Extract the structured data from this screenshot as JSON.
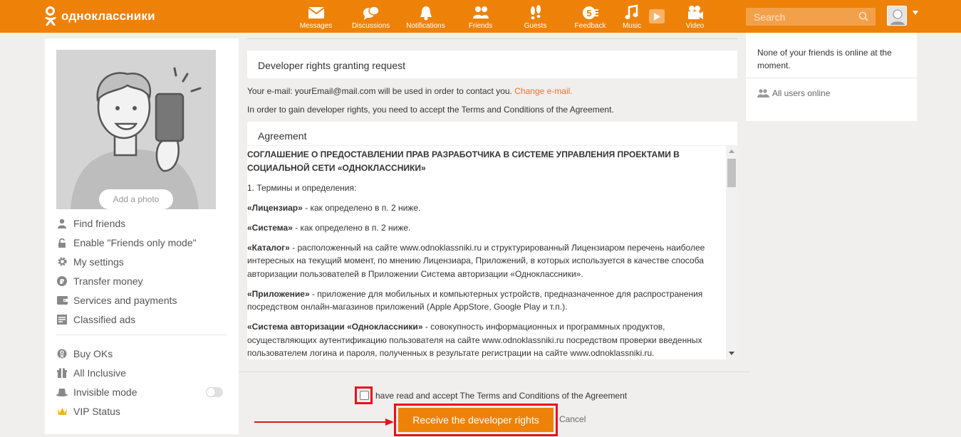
{
  "header": {
    "logo_text": "одноклассники",
    "nav": [
      {
        "label": "Messages",
        "icon": "messages-icon"
      },
      {
        "label": "Discussions",
        "icon": "discussions-icon"
      },
      {
        "label": "Notifications",
        "icon": "bell-icon"
      },
      {
        "label": "Friends",
        "icon": "friends-icon"
      },
      {
        "label": "Guests",
        "icon": "footprints-icon"
      },
      {
        "label": "Feedback",
        "icon": "feedback-icon"
      },
      {
        "label": "Music",
        "icon": "music-note-icon"
      },
      {
        "label": "Video",
        "icon": "video-camera-icon"
      }
    ],
    "search_placeholder": "Search"
  },
  "left": {
    "add_photo": "Add a photo",
    "menu": [
      {
        "label": "Find friends",
        "icon": "person-icon"
      },
      {
        "label": "Enable \"Friends only mode\"",
        "icon": "lock-icon"
      },
      {
        "label": "My settings",
        "icon": "gear-icon"
      },
      {
        "label": "Transfer money",
        "icon": "ruble-icon"
      },
      {
        "label": "Services and payments",
        "icon": "wallet-icon"
      },
      {
        "label": "Classified ads",
        "icon": "ads-icon"
      }
    ],
    "menu2": [
      {
        "label": "Buy OKs",
        "icon": "ok-coin-icon"
      },
      {
        "label": "All Inclusive",
        "icon": "gift-icon"
      },
      {
        "label": "Invisible mode",
        "icon": "hat-icon"
      },
      {
        "label": "VIP Status",
        "icon": "crown-icon"
      }
    ]
  },
  "main": {
    "title": "Developer rights granting request",
    "email_text": "Your e-mail: yourEmail@mail.com will be used in order to contact you.",
    "change_email": "Change e-mail.",
    "terms_intro": "In order to gain developer rights, you need to accept the Terms and Conditions of the Agreement.",
    "agreement_title": "Agreement",
    "agreement": {
      "heading": "СОГЛАШЕНИЕ О ПРЕДОСТАВЛЕНИИ ПРАВ РАЗРАБОТЧИКА В СИСТЕМЕ УПРАВЛЕНИЯ ПРОЕКТАМИ В СОЦИАЛЬНОЙ СЕТИ «ОДНОКЛАССНИКИ»",
      "section1": "1. Термины и определения:",
      "p1_term": "«Лицензиар»",
      "p1_text": " - как определено в п. 2 ниже.",
      "p2_term": "«Система»",
      "p2_text": " - как определено в п. 2 ниже.",
      "p3_term": "«Каталог»",
      "p3_text": " - расположенный на сайте www.odnoklassniki.ru и структурированный Лицензиаром перечень наиболее интересных на текущий момент, по мнению Лицензиара, Приложений, в которых используется в качестве способа авторизации пользователей в Приложении Система авторизации «Одноклассники».",
      "p4_term": "«Приложение»",
      "p4_text": " - приложение для мобильных и компьютерных устройств, предназначенное для распространения посредством онлайн-магазинов приложений (Apple AppStore, Google Play и т.п.).",
      "p5_term": "«Система авторизации «Одноклассники»",
      "p5_text": " - совокупность информационных и программных продуктов, осуществляющих аутентификацию пользователя на сайте www.odnoklassniki.ru посредством проверки введенных пользователем логина и пароля, полученных в результате регистрации на сайте www.odnoklassniki.ru."
    },
    "checkbox_label": "have read and accept The Terms and Conditions of the Agreement",
    "submit": "Receive the developer rights",
    "cancel": "Cancel"
  },
  "right": {
    "no_friends": "None of your friends is online at the moment.",
    "all_online": "All users online"
  },
  "colors": {
    "brand": "#ee8208",
    "highlight": "#e8101a",
    "link": "#eb722e"
  }
}
